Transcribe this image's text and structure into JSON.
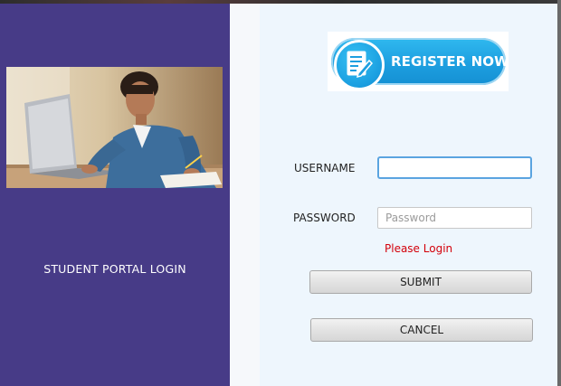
{
  "left_panel": {
    "title": "STUDENT PORTAL LOGIN",
    "background_color": "#473b87",
    "photo_icon": "student-with-laptop-photo"
  },
  "register": {
    "label": "REGISTER NOW",
    "icon": "register-form-pen-icon",
    "color": "#1d9fe0"
  },
  "form": {
    "username_label": "USERNAME",
    "username_value": "",
    "password_label": "PASSWORD",
    "password_placeholder": "Password",
    "status_message": "Please Login",
    "status_color": "#d3000b",
    "submit_label": "SUBMIT",
    "cancel_label": "CANCEL"
  }
}
